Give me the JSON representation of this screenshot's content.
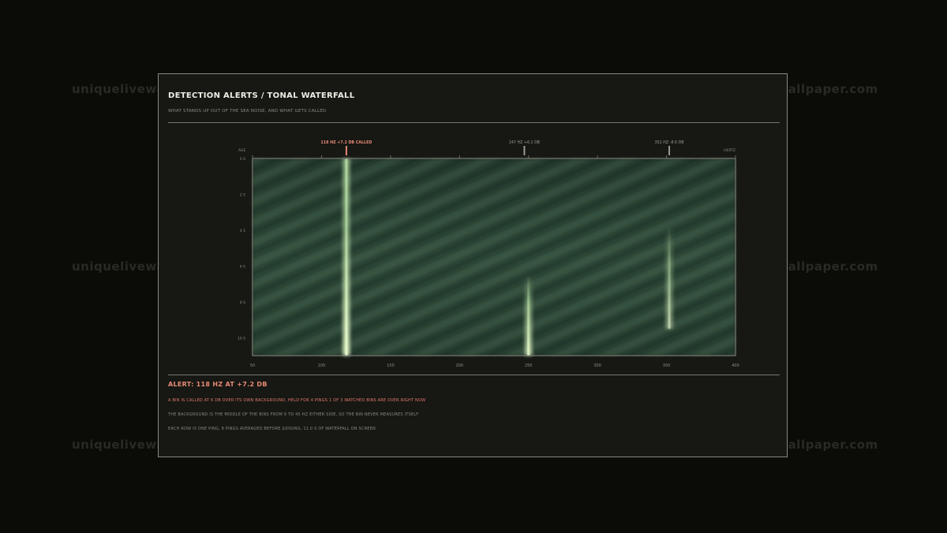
{
  "watermark": "uniquelivewallpaper.com",
  "header": {
    "title": "DETECTION ALERTS / TONAL WATERFALL",
    "subtitle": "WHAT STANDS UP OUT OF THE SEA NOISE, AND WHAT GETS CALLED"
  },
  "colors": {
    "called": "#e78a76",
    "watched": "#9a9a92",
    "waterfall_bg": "#2e4636",
    "line": "#b9e0a6"
  },
  "chart_data": {
    "type": "heatmap",
    "xlabel": "HERTZ",
    "ylabel": "AGE",
    "xlim": [
      50,
      400
    ],
    "ylim": [
      0,
      11
    ],
    "x_ticks": [
      50,
      100,
      150,
      200,
      250,
      300,
      350,
      400
    ],
    "y_ticks": [
      "0 S",
      "2 S",
      "4 S",
      "6 S",
      "8 S",
      "10 S"
    ],
    "y_tick_values": [
      0,
      2,
      4,
      6,
      8,
      10
    ],
    "markers": [
      {
        "freq": 118,
        "label": "118 HZ  +7.2 DB  CALLED",
        "called": true
      },
      {
        "freq": 247,
        "label": "247 HZ  +6.1 DB",
        "called": false
      },
      {
        "freq": 352,
        "label": "352 HZ  -8.6 DB",
        "called": false
      }
    ],
    "tonal_lines": [
      {
        "freq": 118,
        "from_s": 0,
        "to_s": 11,
        "strength": 1.0
      },
      {
        "freq": 250,
        "from_s": 6.5,
        "to_s": 11,
        "strength": 0.85
      },
      {
        "freq": 352,
        "from_s": 3.8,
        "to_s": 9.5,
        "strength": 0.55
      }
    ]
  },
  "alert": {
    "title": "ALERT: 118 HZ AT +7.2 DB",
    "line1": "A BIN IS CALLED AT 6 DB OVER ITS OWN BACKGROUND, HELD FOR 4 PINGS   1 OF 3 WATCHED BINS ARE OVER RIGHT NOW",
    "line2": "THE BACKGROUND IS THE MIDDLE OF THE BINS FROM 9 TO 45 HZ EITHER SIDE, SO THE BIN NEVER MEASURES ITSELF",
    "line3": "EACH ROW IS ONE PING, 8 PINGS AVERAGED BEFORE JUDGING, 11.0 S OF WATERFALL ON SCREEN"
  }
}
